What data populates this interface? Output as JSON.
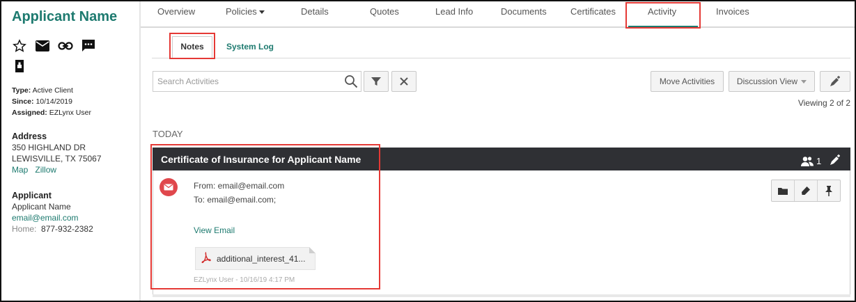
{
  "sidebar": {
    "title": "Applicant Name",
    "meta": {
      "type_label": "Type:",
      "type_value": "Active Client",
      "since_label": "Since:",
      "since_value": "10/14/2019",
      "assigned_label": "Assigned:",
      "assigned_value": "EZLynx User"
    },
    "address": {
      "title": "Address",
      "line1": "350 HIGHLAND DR",
      "line2": "LEWISVILLE, TX 75067",
      "map_link": "Map",
      "zillow_link": "Zillow"
    },
    "applicant": {
      "title": "Applicant",
      "name": "Applicant Name",
      "email": "email@email.com",
      "home_label": "Home:",
      "home_phone": "877-932-2382"
    }
  },
  "topnav": {
    "tabs": [
      "Overview",
      "Policies",
      "Details",
      "Quotes",
      "Lead Info",
      "Documents",
      "Certificates",
      "Activity",
      "Invoices"
    ],
    "active": "Activity"
  },
  "subnav": {
    "notes": "Notes",
    "system_log": "System Log"
  },
  "toolbar": {
    "search_placeholder": "Search Activities",
    "move_activities": "Move Activities",
    "discussion_view": "Discussion View",
    "viewing": "Viewing 2 of 2"
  },
  "feed": {
    "group_label": "TODAY",
    "card": {
      "title": "Certificate of Insurance for Applicant Name",
      "participants": "1",
      "from": "From: email@email.com",
      "to": "To: email@email.com;",
      "view_email": "View Email",
      "attachment": "additional_interest_41...",
      "byline": "EZLynx User - 10/16/19 4:17 PM"
    }
  },
  "colors": {
    "brand_teal": "#1d7a6f",
    "highlight_red": "#e53935",
    "card_header": "#2f3034",
    "mail_red": "#e0474c"
  }
}
